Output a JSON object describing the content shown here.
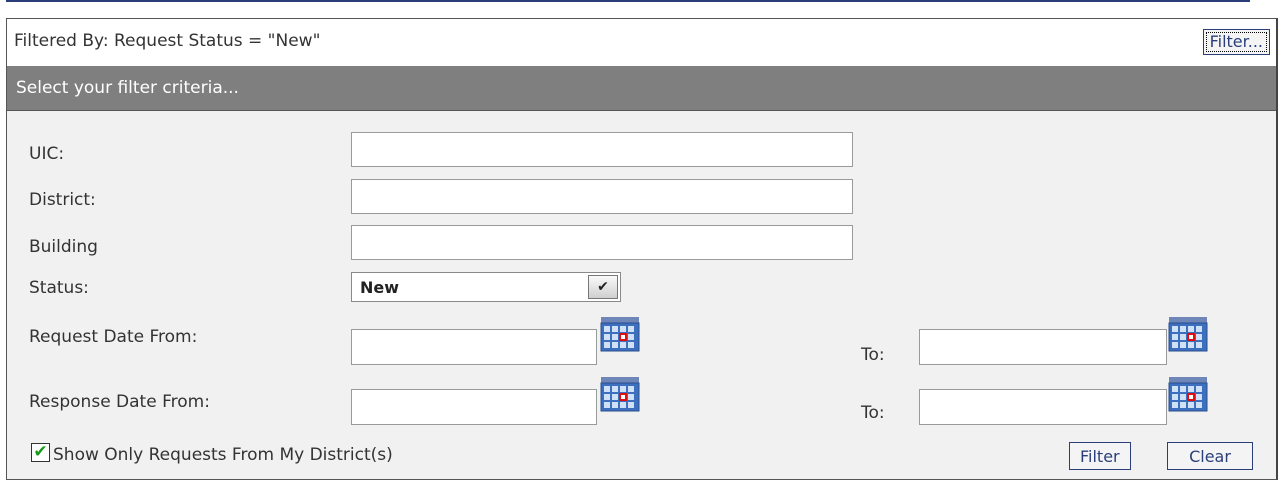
{
  "filter_bar": {
    "filtered_by": "Filtered By: Request Status = \"New\"",
    "filter_button": "Filter..."
  },
  "criteria": {
    "header": "Select your filter criteria...",
    "uic_label": "UIC:",
    "uic_value": "",
    "district_label": "District:",
    "district_value": "",
    "building_label": "Building",
    "building_value": "",
    "status_label": "Status:",
    "status_value": "New",
    "request_date_from_label": "Request Date From:",
    "request_date_from_value": "",
    "request_date_to_label": "To:",
    "request_date_to_value": "",
    "response_date_from_label": "Response Date From:",
    "response_date_from_value": "",
    "response_date_to_label": "To:",
    "response_date_to_value": "",
    "show_only_my_district_label": "Show Only Requests From My District(s)",
    "show_only_my_district_checked": true,
    "filter_button": "Filter",
    "clear_button": "Clear"
  },
  "colors": {
    "header_bg": "#7f7f7f",
    "panel_bg": "#f1f1f1",
    "button_border": "#2a3f7a",
    "checkmark": "#1a9a1a"
  }
}
